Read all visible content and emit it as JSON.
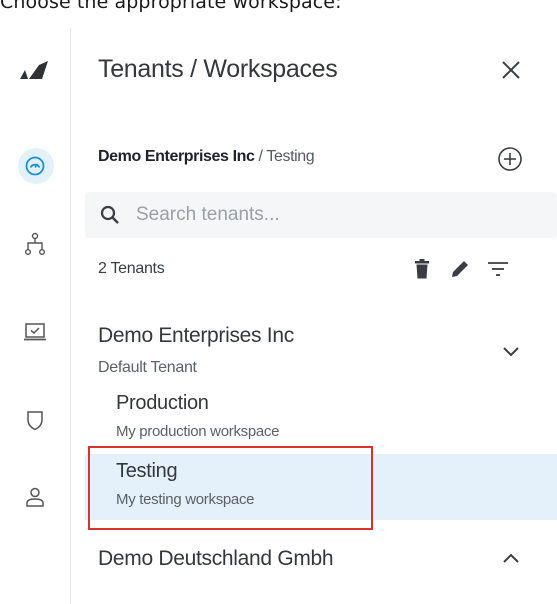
{
  "caption": "Choose the appropriate workspace:",
  "rail": {
    "items": [
      {
        "name": "logo",
        "icon": "brand-logo-icon"
      },
      {
        "name": "dashboard",
        "icon": "gauge-icon",
        "active": true
      },
      {
        "name": "hierarchy",
        "icon": "hierarchy-icon"
      },
      {
        "name": "monitor",
        "icon": "monitor-check-icon"
      },
      {
        "name": "shield",
        "icon": "shield-icon"
      },
      {
        "name": "user",
        "icon": "user-icon"
      }
    ]
  },
  "panel": {
    "title": "Tenants / Workspaces",
    "close_icon": "close-icon",
    "breadcrumb": {
      "org": "Demo Enterprises Inc",
      "separator": " / ",
      "workspace": "Testing"
    },
    "add_icon": "plus-circle-icon",
    "search": {
      "placeholder": "Search tenants..."
    },
    "count_label": "2 Tenants",
    "tools": [
      "trash-icon",
      "pencil-icon",
      "filter-icon"
    ]
  },
  "tenants": [
    {
      "name": "Demo Enterprises Inc",
      "subtitle": "Default Tenant",
      "expanded": true,
      "chevron_icon": "chevron-down-icon",
      "workspaces": [
        {
          "name": "Production",
          "description": "My production workspace",
          "selected": false
        },
        {
          "name": "Testing",
          "description": "My testing workspace",
          "selected": true
        }
      ]
    },
    {
      "name": "Demo Deutschland Gmbh",
      "expanded": false,
      "chevron_icon": "chevron-up-icon"
    }
  ],
  "colors": {
    "accent": "#1a8fd6",
    "selected_bg": "#e4f1fb",
    "highlight_border": "#d6342c",
    "search_bg": "#f4f6f8"
  }
}
